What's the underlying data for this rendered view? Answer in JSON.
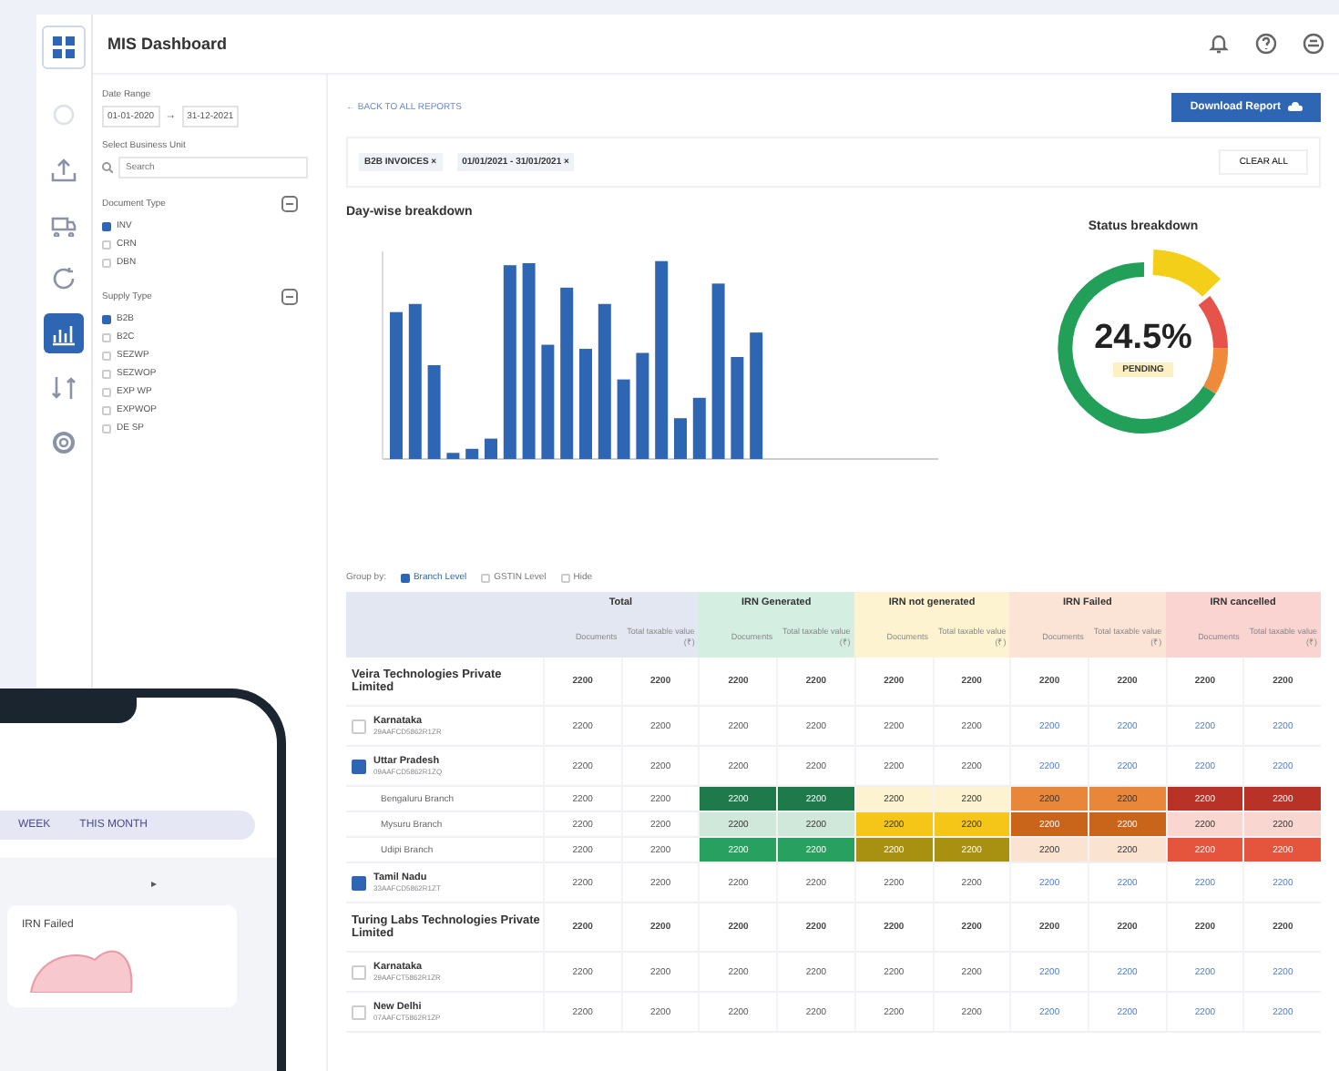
{
  "window": {
    "title": "MIS Dashboard"
  },
  "rail": [
    {
      "selected": false
    },
    {
      "selected": false
    },
    {
      "selected": false
    },
    {
      "selected": false
    },
    {
      "selected": false
    },
    {
      "selected": true
    },
    {
      "selected": false
    },
    {
      "selected": false
    }
  ],
  "filters": {
    "date_label": "Date Range",
    "date_from": "01-01-2020",
    "date_arrow": "→",
    "date_to": "31-12-2021",
    "unit_label": "Select Business Unit",
    "search_placeholder": "Search",
    "groups": [
      {
        "title": "Document Type",
        "options": [
          {
            "label": "INV",
            "selected": true
          },
          {
            "label": "CRN",
            "selected": false
          },
          {
            "label": "DBN",
            "selected": false
          }
        ]
      },
      {
        "title": "Supply Type",
        "options": [
          {
            "label": "B2B",
            "selected": true
          },
          {
            "label": "B2C",
            "selected": false
          },
          {
            "label": "SEZWP",
            "selected": false
          },
          {
            "label": "SEZWOP",
            "selected": false
          },
          {
            "label": "EXP WP",
            "selected": false
          },
          {
            "label": "EXPWOP",
            "selected": false
          },
          {
            "label": "DE SP",
            "selected": false
          }
        ]
      }
    ]
  },
  "back_link": "← BACK TO ALL REPORTS",
  "download_button": "Download Report",
  "chips": [
    "B2B INVOICES ×",
    "01/01/2021 - 31/01/2021 ×"
  ],
  "clear_button": "CLEAR ALL",
  "bar_chart_title": "Day-wise breakdown",
  "status_title": "Status breakdown",
  "status_value": "24.5%",
  "status_label": "PENDING",
  "group_by": {
    "label": "Group by:",
    "options": [
      {
        "label": "Branch Level",
        "selected": true
      },
      {
        "label": "GSTIN Level",
        "selected": false
      },
      {
        "label": "Hide",
        "selected": false
      }
    ]
  },
  "table": {
    "groups": [
      {
        "label": "Total",
        "color": "#e3e7f2",
        "subcolumns": [
          "Documents",
          "Total taxable value (₹)"
        ]
      },
      {
        "label": "IRN Generated",
        "color": "#d4eee2",
        "subcolumns": [
          "Documents",
          "Total taxable value (₹)"
        ]
      },
      {
        "label": "IRN not generated",
        "color": "#fdf3d0",
        "subcolumns": [
          "Documents",
          "Total taxable value (₹)"
        ]
      },
      {
        "label": "IRN Failed",
        "color": "#fbe3d6",
        "subcolumns": [
          "Documents",
          "Total taxable value (₹)"
        ]
      },
      {
        "label": "IRN cancelled",
        "color": "#f9d4d0",
        "subcolumns": [
          "Documents",
          "Total taxable value (₹)"
        ]
      }
    ],
    "rows": [
      {
        "kind": "company",
        "name": "Veira Technologies Private Limited",
        "cells": [
          "2200",
          "2200",
          "2200",
          "2200",
          "2200",
          "2200",
          "2200",
          "2200",
          "2200",
          "2200"
        ]
      },
      {
        "kind": "state",
        "name": "Karnataka",
        "gstin": "29AAFCD5862R1ZR",
        "checked": false,
        "cells": [
          "2200",
          "2200",
          "2200",
          "2200",
          "2200",
          "2200",
          "2200",
          "2200",
          "2200",
          "2200"
        ]
      },
      {
        "kind": "state",
        "name": "Uttar Pradesh",
        "gstin": "09AAFCD5862R1ZQ",
        "checked": true,
        "cells": [
          "2200",
          "2200",
          "2200",
          "2200",
          "2200",
          "2200",
          "2200",
          "2200",
          "2200",
          "2200"
        ]
      },
      {
        "kind": "branch",
        "name": "Bengaluru Branch",
        "cells": [
          {
            "text": "2200"
          },
          {
            "text": "2200"
          },
          {
            "text": "2200",
            "color": "#1e7a4a"
          },
          {
            "text": "2200",
            "color": "#1e7a4a"
          },
          {
            "text": "2200",
            "color": "#fdf3d0"
          },
          {
            "text": "2200",
            "color": "#fdf3d0"
          },
          {
            "text": "2200",
            "color": "#e8873a"
          },
          {
            "text": "2200",
            "color": "#e8873a"
          },
          {
            "text": "2200",
            "color": "#b83228"
          },
          {
            "text": "2200",
            "color": "#b83228"
          }
        ]
      },
      {
        "kind": "branch",
        "name": "Mysuru Branch",
        "cells": [
          {
            "text": "2200"
          },
          {
            "text": "2200"
          },
          {
            "text": "2200",
            "color": "#cfe8da"
          },
          {
            "text": "2200",
            "color": "#cfe8da"
          },
          {
            "text": "2200",
            "color": "#f5c518"
          },
          {
            "text": "2200",
            "color": "#f5c518"
          },
          {
            "text": "2200",
            "color": "#c8651a"
          },
          {
            "text": "2200",
            "color": "#c8651a"
          },
          {
            "text": "2200",
            "color": "#f9d6d0"
          },
          {
            "text": "2200",
            "color": "#f9d6d0"
          }
        ]
      },
      {
        "kind": "branch",
        "name": "Udipi Branch",
        "cells": [
          {
            "text": "2200"
          },
          {
            "text": "2200"
          },
          {
            "text": "2200",
            "color": "#27a060"
          },
          {
            "text": "2200",
            "color": "#27a060"
          },
          {
            "text": "2200",
            "color": "#a89010"
          },
          {
            "text": "2200",
            "color": "#a89010"
          },
          {
            "text": "2200",
            "color": "#fbe3d2"
          },
          {
            "text": "2200",
            "color": "#fbe3d2"
          },
          {
            "text": "2200",
            "color": "#e5553e"
          },
          {
            "text": "2200",
            "color": "#e5553e"
          }
        ]
      },
      {
        "kind": "state",
        "name": "Tamil Nadu",
        "gstin": "33AAFCD5862R1ZT",
        "checked": true,
        "cells": [
          "2200",
          "2200",
          "2200",
          "2200",
          "2200",
          "2200",
          "2200",
          "2200",
          "2200",
          "2200"
        ]
      },
      {
        "kind": "company",
        "name": "Turing Labs Technologies Private Limited",
        "cells": [
          "2200",
          "2200",
          "2200",
          "2200",
          "2200",
          "2200",
          "2200",
          "2200",
          "2200",
          "2200"
        ]
      },
      {
        "kind": "state",
        "name": "Karnataka",
        "gstin": "29AAFCT5862R1ZR",
        "checked": false,
        "cells": [
          "2200",
          "2200",
          "2200",
          "2200",
          "2200",
          "2200",
          "2200",
          "2200",
          "2200",
          "2200"
        ]
      },
      {
        "kind": "state",
        "name": "New Delhi",
        "gstin": "07AAFCT5862R1ZP",
        "checked": false,
        "cells": [
          "2200",
          "2200",
          "2200",
          "2200",
          "2200",
          "2200",
          "2200",
          "2200",
          "2200",
          "2200"
        ]
      }
    ]
  },
  "phone": {
    "tabs": [
      {
        "label": "WEEK",
        "selected": false
      },
      {
        "label": "THIS MONTH",
        "selected": false
      }
    ],
    "arrow": "▸",
    "card_title": "IRN Failed"
  }
}
